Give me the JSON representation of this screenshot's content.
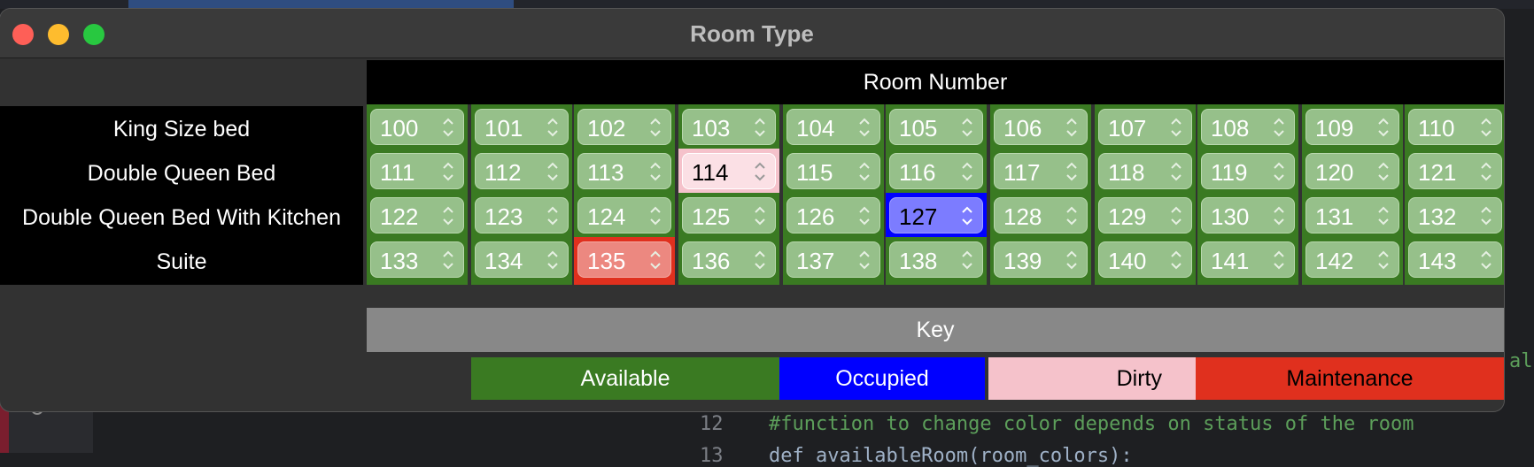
{
  "window": {
    "title": "Room Type"
  },
  "header": {
    "room_number": "Room Number"
  },
  "rows": [
    {
      "label": "King Size bed",
      "rooms": [
        {
          "num": "100",
          "status": "available"
        },
        {
          "num": "101",
          "status": "available"
        },
        {
          "num": "102",
          "status": "available"
        },
        {
          "num": "103",
          "status": "available"
        },
        {
          "num": "104",
          "status": "available"
        },
        {
          "num": "105",
          "status": "available"
        },
        {
          "num": "106",
          "status": "available"
        },
        {
          "num": "107",
          "status": "available"
        },
        {
          "num": "108",
          "status": "available"
        },
        {
          "num": "109",
          "status": "available"
        },
        {
          "num": "110",
          "status": "available"
        }
      ]
    },
    {
      "label": "Double Queen Bed",
      "rooms": [
        {
          "num": "111",
          "status": "available"
        },
        {
          "num": "112",
          "status": "available"
        },
        {
          "num": "113",
          "status": "available"
        },
        {
          "num": "114",
          "status": "dirty"
        },
        {
          "num": "115",
          "status": "available"
        },
        {
          "num": "116",
          "status": "available"
        },
        {
          "num": "117",
          "status": "available"
        },
        {
          "num": "118",
          "status": "available"
        },
        {
          "num": "119",
          "status": "available"
        },
        {
          "num": "120",
          "status": "available"
        },
        {
          "num": "121",
          "status": "available"
        }
      ]
    },
    {
      "label": "Double Queen Bed With Kitchen",
      "rooms": [
        {
          "num": "122",
          "status": "available"
        },
        {
          "num": "123",
          "status": "available"
        },
        {
          "num": "124",
          "status": "available"
        },
        {
          "num": "125",
          "status": "available"
        },
        {
          "num": "126",
          "status": "available"
        },
        {
          "num": "127",
          "status": "occupied"
        },
        {
          "num": "128",
          "status": "available"
        },
        {
          "num": "129",
          "status": "available"
        },
        {
          "num": "130",
          "status": "available"
        },
        {
          "num": "131",
          "status": "available"
        },
        {
          "num": "132",
          "status": "available"
        }
      ]
    },
    {
      "label": "Suite",
      "rooms": [
        {
          "num": "133",
          "status": "available"
        },
        {
          "num": "134",
          "status": "available"
        },
        {
          "num": "135",
          "status": "maintenance"
        },
        {
          "num": "136",
          "status": "available"
        },
        {
          "num": "137",
          "status": "available"
        },
        {
          "num": "138",
          "status": "available"
        },
        {
          "num": "139",
          "status": "available"
        },
        {
          "num": "140",
          "status": "available"
        },
        {
          "num": "141",
          "status": "available"
        },
        {
          "num": "142",
          "status": "available"
        },
        {
          "num": "143",
          "status": "available"
        }
      ]
    }
  ],
  "key": {
    "title": "Key",
    "available": "Available",
    "occupied": "Occupied",
    "dirty": "Dirty",
    "maintenance": "Maintenance"
  },
  "colors": {
    "available": "#3a7a22",
    "occupied": "#0000ff",
    "dirty": "#f5c2cb",
    "maintenance": "#e0301e"
  },
  "background_editor": {
    "line12_number": "12",
    "line12_comment": "#function to change color depends on status of the room",
    "line13_number": "13",
    "line13_code": "def availableRoom(room_colors):",
    "partial_text": "al"
  }
}
